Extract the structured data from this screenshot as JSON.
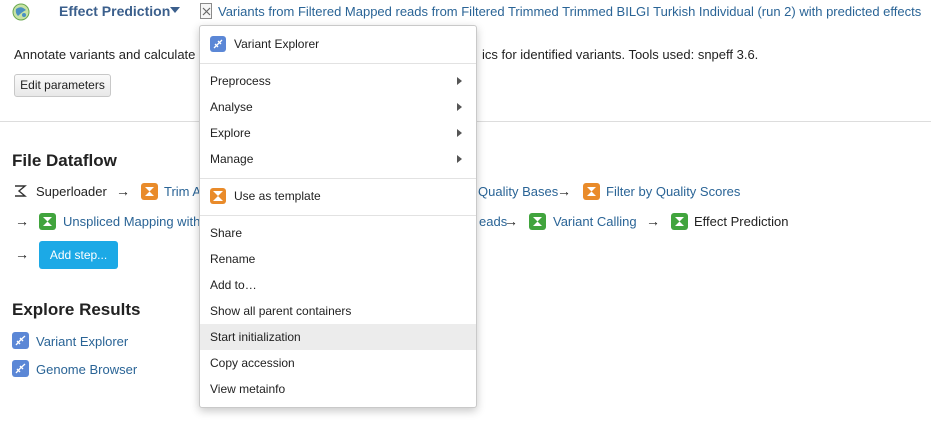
{
  "colors": {
    "link": "#2a6496",
    "app_title": "#3b5f8c",
    "primary_button": "#1ca9e6",
    "tool_orange": "#e98b2a",
    "tool_green": "#41a43d",
    "explorer_blue": "#5b87d6"
  },
  "header": {
    "app_title": "Effect Prediction",
    "document_title": "Variants from Filtered Mapped reads from Filtered Trimmed Trimmed BILGI Turkish Individual (run 2) with predicted effects"
  },
  "description": {
    "lead": "Annotate variants and calculate",
    "tail": "ics for identified variants. Tools used: snpeff 3.6."
  },
  "buttons": {
    "edit_parameters": "Edit parameters",
    "add_step": "Add step..."
  },
  "dataflow": {
    "heading": "File Dataflow",
    "row1": {
      "superloader": "Superloader",
      "trim_partial": "Trim A",
      "quality_bases_partial": "Quality Bases",
      "filter_quality": "Filter by Quality Scores"
    },
    "row2": {
      "unspliced_partial": "Unspliced Mapping with",
      "reads_partial": "eads",
      "variant_calling": "Variant Calling",
      "effect_prediction": "Effect Prediction"
    },
    "arrow": "→"
  },
  "results": {
    "heading": "Explore Results",
    "items": [
      "Variant Explorer",
      "Genome Browser"
    ]
  },
  "menu": {
    "top": "Variant Explorer",
    "submenus": [
      "Preprocess",
      "Analyse",
      "Explore",
      "Manage"
    ],
    "template": "Use as template",
    "actions": [
      "Share",
      "Rename",
      "Add to…",
      "Show all parent containers",
      "Start initialization",
      "Copy accession",
      "View metainfo"
    ],
    "highlighted": "Start initialization"
  }
}
